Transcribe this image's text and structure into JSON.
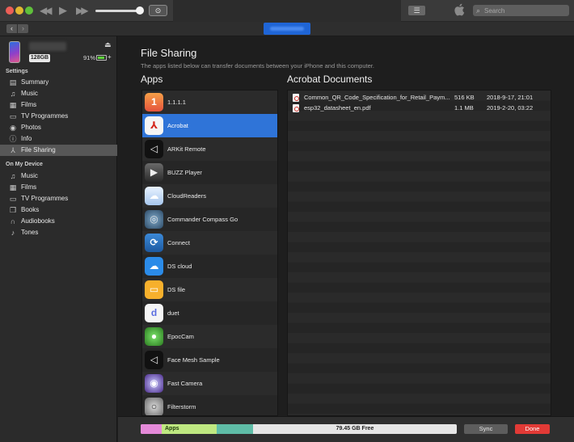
{
  "colors": {
    "accent": "#2f74d8",
    "device_button": "#1f65d6",
    "done_button": "#e23a36",
    "capacity_photos": "#e58ad9",
    "capacity_apps": "#bfe881",
    "capacity_other": "#5fbda7",
    "battery_fill": "#5fd23d"
  },
  "titlebar": {
    "search_placeholder": "Search",
    "icons": {
      "prev": "rewind-icon",
      "play": "play-icon",
      "next": "fast-forward-icon",
      "airplay": "airplay-icon",
      "apple": "apple-logo-icon",
      "list_view": "list-view-icon",
      "search": "search-icon"
    },
    "volume_level": 0.9
  },
  "device": {
    "capacity": "128GB",
    "battery_percent": "91%",
    "battery_level": 0.91
  },
  "sidebar": {
    "settings_header": "Settings",
    "settings_items": [
      {
        "label": "Summary",
        "icon": "summary-icon"
      },
      {
        "label": "Music",
        "icon": "music-note-icon"
      },
      {
        "label": "Films",
        "icon": "film-icon"
      },
      {
        "label": "TV Programmes",
        "icon": "tv-icon"
      },
      {
        "label": "Photos",
        "icon": "camera-icon"
      },
      {
        "label": "Info",
        "icon": "info-icon"
      },
      {
        "label": "File Sharing",
        "icon": "file-sharing-icon",
        "selected": true
      }
    ],
    "ondevice_header": "On My Device",
    "ondevice_items": [
      {
        "label": "Music",
        "icon": "music-note-icon"
      },
      {
        "label": "Films",
        "icon": "film-icon"
      },
      {
        "label": "TV Programmes",
        "icon": "tv-icon"
      },
      {
        "label": "Books",
        "icon": "book-icon"
      },
      {
        "label": "Audiobooks",
        "icon": "headphones-icon"
      },
      {
        "label": "Tones",
        "icon": "bell-icon"
      }
    ]
  },
  "main": {
    "title": "File Sharing",
    "subtitle": "The apps listed below can transfer documents between your iPhone and this computer.",
    "apps_heading": "Apps",
    "docs_heading": "Acrobat Documents",
    "apps": [
      {
        "label": "1.1.1.1"
      },
      {
        "label": "Acrobat",
        "selected": true
      },
      {
        "label": "ARKit Remote"
      },
      {
        "label": "BUZZ Player"
      },
      {
        "label": "CloudReaders"
      },
      {
        "label": "Commander Compass Go"
      },
      {
        "label": "Connect"
      },
      {
        "label": "DS cloud"
      },
      {
        "label": "DS file"
      },
      {
        "label": "duet"
      },
      {
        "label": "EpocCam"
      },
      {
        "label": "Face Mesh Sample"
      },
      {
        "label": "Fast Camera"
      },
      {
        "label": "Filterstorm"
      }
    ],
    "documents": [
      {
        "name": "Common_QR_Code_Specification_for_Retail_Paym...",
        "size": "516 KB",
        "date": "2018-9-17, 21:01"
      },
      {
        "name": "esp32_datasheet_en.pdf",
        "size": "1.1 MB",
        "date": "2019-2-20, 03:22"
      }
    ]
  },
  "bottombar": {
    "apps_label": "Apps",
    "free_label": "79.45 GB Free",
    "sync_label": "Sync",
    "done_label": "Done"
  }
}
